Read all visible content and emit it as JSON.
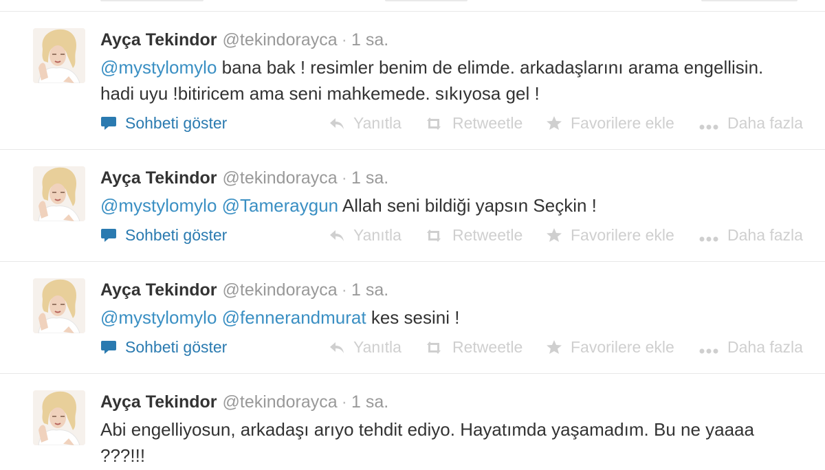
{
  "tweets": [
    {
      "name": "Ayça Tekindor",
      "handle": "@tekindorayca",
      "separator": "·",
      "time": "1 sa.",
      "parts": [
        {
          "type": "mention",
          "text": "@mystylomylo"
        },
        {
          "type": "text",
          "text": " bana bak ! resimler benim de elimde. arkadaşlarını arama engellisin. hadi uyu !bitiricem ama seni mahkemede. sıkıyosa gel !"
        }
      ]
    },
    {
      "name": "Ayça Tekindor",
      "handle": "@tekindorayca",
      "separator": "·",
      "time": "1 sa.",
      "parts": [
        {
          "type": "mention",
          "text": "@mystylomylo"
        },
        {
          "type": "text",
          "text": " "
        },
        {
          "type": "mention",
          "text": "@Tameraygun"
        },
        {
          "type": "text",
          "text": " Allah seni bildiği yapsın Seçkin !"
        }
      ]
    },
    {
      "name": "Ayça Tekindor",
      "handle": "@tekindorayca",
      "separator": "·",
      "time": "1 sa.",
      "parts": [
        {
          "type": "mention",
          "text": "@mystylomylo"
        },
        {
          "type": "text",
          "text": " "
        },
        {
          "type": "mention",
          "text": "@fennerandmurat"
        },
        {
          "type": "text",
          "text": " kes sesini !"
        }
      ]
    },
    {
      "name": "Ayça Tekindor",
      "handle": "@tekindorayca",
      "separator": "·",
      "time": "1 sa.",
      "parts": [
        {
          "type": "text",
          "text": "Abi engelliyosun, arkadaşı arıyo tehdit ediyo. Hayatımda yaşamadım. Bu ne yaaaa ???!!!"
        }
      ]
    }
  ],
  "actions": {
    "conversation": "Sohbeti göster",
    "reply": "Yanıtla",
    "retweet": "Retweetle",
    "favorite": "Favorilere ekle",
    "more": "Daha fazla"
  },
  "icons": {
    "conversation": "speech-bubble-icon",
    "reply": "reply-arrow-icon",
    "retweet": "retweet-icon",
    "favorite": "star-icon",
    "more": "ellipsis-icon"
  },
  "colors": {
    "mention": "#3a8fc3",
    "conversation": "#2a7ab0",
    "muted_action": "#cfcfcf",
    "name": "#333333",
    "meta": "#999999"
  }
}
